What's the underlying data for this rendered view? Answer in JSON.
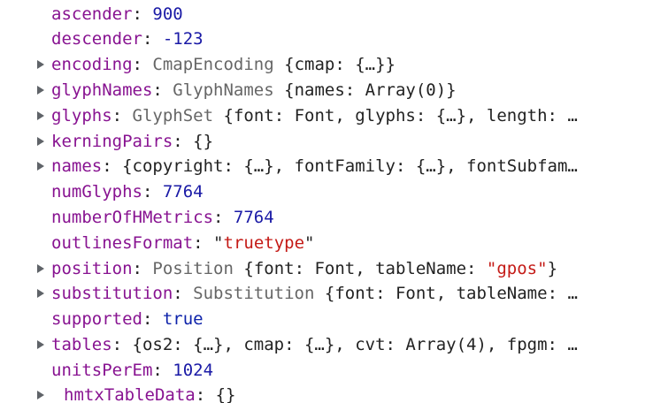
{
  "rows": [
    {
      "key": "ascender",
      "value": "900"
    },
    {
      "key": "descender",
      "value": "-123"
    },
    {
      "key": "encoding",
      "class_name": "CmapEncoding",
      "preview": "{cmap: {…}}"
    },
    {
      "key": "glyphNames",
      "class_name": "GlyphNames",
      "preview": "{names: Array(0)}"
    },
    {
      "key": "glyphs",
      "class_name": "GlyphSet",
      "preview": "{font: Font, glyphs: {…}, length: …"
    },
    {
      "key": "kerningPairs",
      "preview": "{}"
    },
    {
      "key": "names",
      "preview": "{copyright: {…}, fontFamily: {…}, fontSubfam…"
    },
    {
      "key": "numGlyphs",
      "value": "7764"
    },
    {
      "key": "numberOfHMetrics",
      "value": "7764"
    },
    {
      "key": "outlinesFormat",
      "quote_open": "\"",
      "value": "truetype",
      "quote_close": "\""
    },
    {
      "key": "position",
      "class_name": "Position",
      "preview_a": "{font: Font, tableName: ",
      "preview_str": "\"gpos\"",
      "preview_b": "}"
    },
    {
      "key": "substitution",
      "class_name": "Substitution",
      "preview": "{font: Font, tableName: …"
    },
    {
      "key": "supported",
      "value": "true"
    },
    {
      "key": "tables",
      "preview": "{os2: {…}, cmap: {…}, cvt: Array(4), fpgm: …"
    },
    {
      "key": "unitsPerEm",
      "value": "1024"
    },
    {
      "key": "hmtxTableData",
      "preview": "{}"
    }
  ],
  "colors": {
    "key": "#881391",
    "number": "#1a1aa6",
    "string": "#c41a16",
    "keyword": "#0d22aa",
    "class_name": "#666666",
    "text": "#222222",
    "triangle": "#5f6368"
  },
  "icons": {
    "expand": "triangle-right-icon"
  }
}
